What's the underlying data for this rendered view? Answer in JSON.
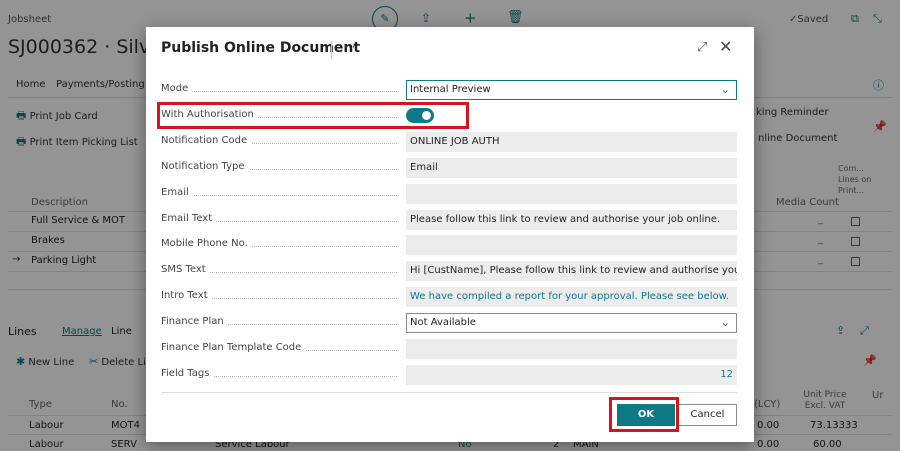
{
  "page": {
    "breadcrumb": "Jobsheet",
    "title": "SJ000362 · Silve",
    "saved_label": "Saved",
    "nav_tabs": [
      "Home",
      "Payments/Posting"
    ],
    "actions": {
      "print_job_card": "Print Job Card",
      "print_item_picking_list": "Print Item Picking List",
      "picking_reminder": "king Reminder",
      "online_document": "nline Document"
    },
    "lines_grid": {
      "headers": {
        "description": "Description",
        "media_count": "Media Count",
        "com_lines": "Com... Lines on Print..."
      },
      "rows": [
        {
          "description": "Full Service & MOT",
          "media": "_"
        },
        {
          "description": "Brakes",
          "media": "_"
        },
        {
          "description": "Parking Light",
          "media": "_",
          "arrow": "→"
        }
      ]
    },
    "lines_section": {
      "title": "Lines",
      "tabs": [
        "Manage",
        "Line"
      ],
      "new_line": "New Line",
      "delete_line": "Delete Lin",
      "headers": {
        "type": "Type",
        "no": "No.",
        "lcy": "(LCY)",
        "unit_price": "Unit Price Excl. VAT",
        "ur": "Ur"
      },
      "rows": [
        {
          "type": "Labour",
          "no": "MOT4",
          "lcy": "0.00",
          "unit_price": "73.13333"
        },
        {
          "type": "Labour",
          "no": "SERV",
          "desc": "Service Labour",
          "flag": "No",
          "qty": "2",
          "code": "MAIN",
          "lcy": "0.00",
          "unit_price": "60.00"
        }
      ]
    }
  },
  "dialog": {
    "title": "Publish Online Document",
    "more_label": "···",
    "fields": [
      {
        "label": "Mode",
        "value": "Internal Preview"
      },
      {
        "label": "With Authorisation",
        "value": true
      },
      {
        "label": "Notification Code",
        "value": "ONLINE JOB AUTH"
      },
      {
        "label": "Notification Type",
        "value": "Email"
      },
      {
        "label": "Email",
        "value": ""
      },
      {
        "label": "Email Text",
        "value": "Please follow this link to review and authorise your job online."
      },
      {
        "label": "Mobile Phone No.",
        "value": ""
      },
      {
        "label": "SMS Text",
        "value": "Hi [CustName], Please follow this link to review and authorise your job onl..."
      },
      {
        "label": "Intro Text",
        "value": "We have compiled a report for your approval. Please see below."
      },
      {
        "label": "Finance Plan",
        "value": "Not Available"
      },
      {
        "label": "Finance Plan Template Code",
        "value": ""
      },
      {
        "label": "Field Tags",
        "value": "12"
      }
    ],
    "ok_label": "OK",
    "cancel_label": "Cancel"
  },
  "colors": {
    "accent": "#0e7a85",
    "highlight": "#d9131e"
  }
}
